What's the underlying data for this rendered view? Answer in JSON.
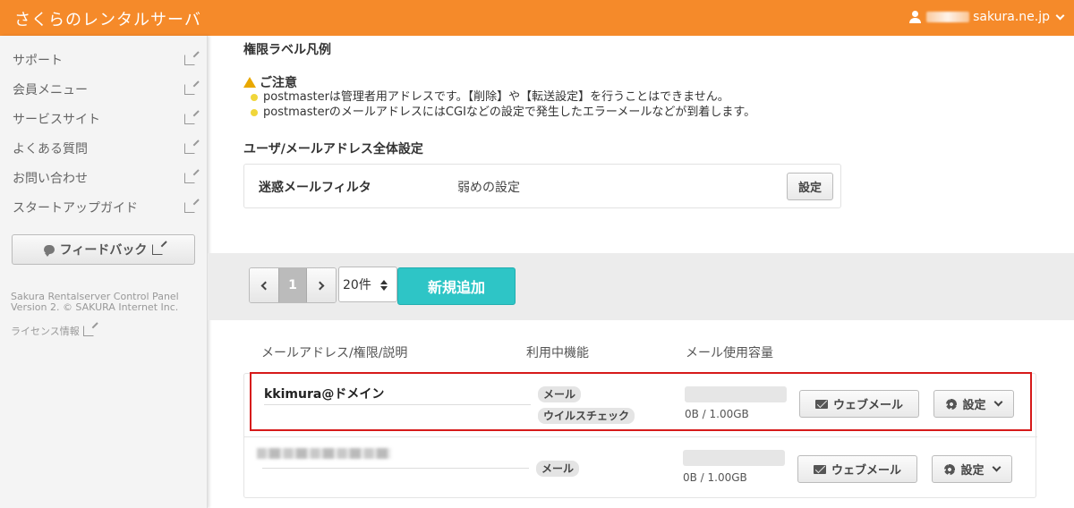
{
  "header": {
    "brand": "さくらのレンタルサーバ",
    "user_domain": "sakura.ne.jp"
  },
  "sidebar": {
    "items": [
      {
        "label": "サポート"
      },
      {
        "label": "会員メニュー"
      },
      {
        "label": "サービスサイト"
      },
      {
        "label": "よくある質問"
      },
      {
        "label": "お問い合わせ"
      },
      {
        "label": "スタートアップガイド"
      }
    ],
    "feedback_label": "フィードバック",
    "footer_line1": "Sakura Rentalserver Control Panel",
    "footer_line2": "Version 2. © SAKURA Internet Inc.",
    "license_label": "ライセンス情報"
  },
  "main": {
    "legend_heading": "権限ラベル凡例",
    "notice_title": "ご注意",
    "notices": [
      "postmasterは管理者用アドレスです。【削除】や【転送設定】を行うことはできません。",
      "postmasterのメールアドレスにはCGIなどの設定で発生したエラーメールなどが到着します。"
    ],
    "global_heading": "ユーザ/メールアドレス全体設定",
    "spam_filter": {
      "label": "迷惑メールフィルタ",
      "value": "弱めの設定",
      "button": "設定"
    },
    "pager": {
      "current_page": "1",
      "per_page": "20件",
      "add_button": "新規追加"
    },
    "columns": {
      "address": "メールアドレス/権限/説明",
      "features": "利用中機能",
      "usage": "メール使用容量"
    },
    "rows": [
      {
        "address": "kkimura@ドメイン",
        "tags": [
          "メール",
          "ウイルスチェック"
        ],
        "usage": "0B / 1.00GB",
        "webmail_button": "ウェブメール",
        "settings_button": "設定"
      },
      {
        "address": "",
        "tags": [
          "メール"
        ],
        "usage": "0B / 1.00GB",
        "webmail_button": "ウェブメール",
        "settings_button": "設定"
      }
    ]
  },
  "colors": {
    "header_bg": "#f58a2a",
    "add_button_bg": "#2ec5c6",
    "highlight_border": "#d61a1a"
  }
}
